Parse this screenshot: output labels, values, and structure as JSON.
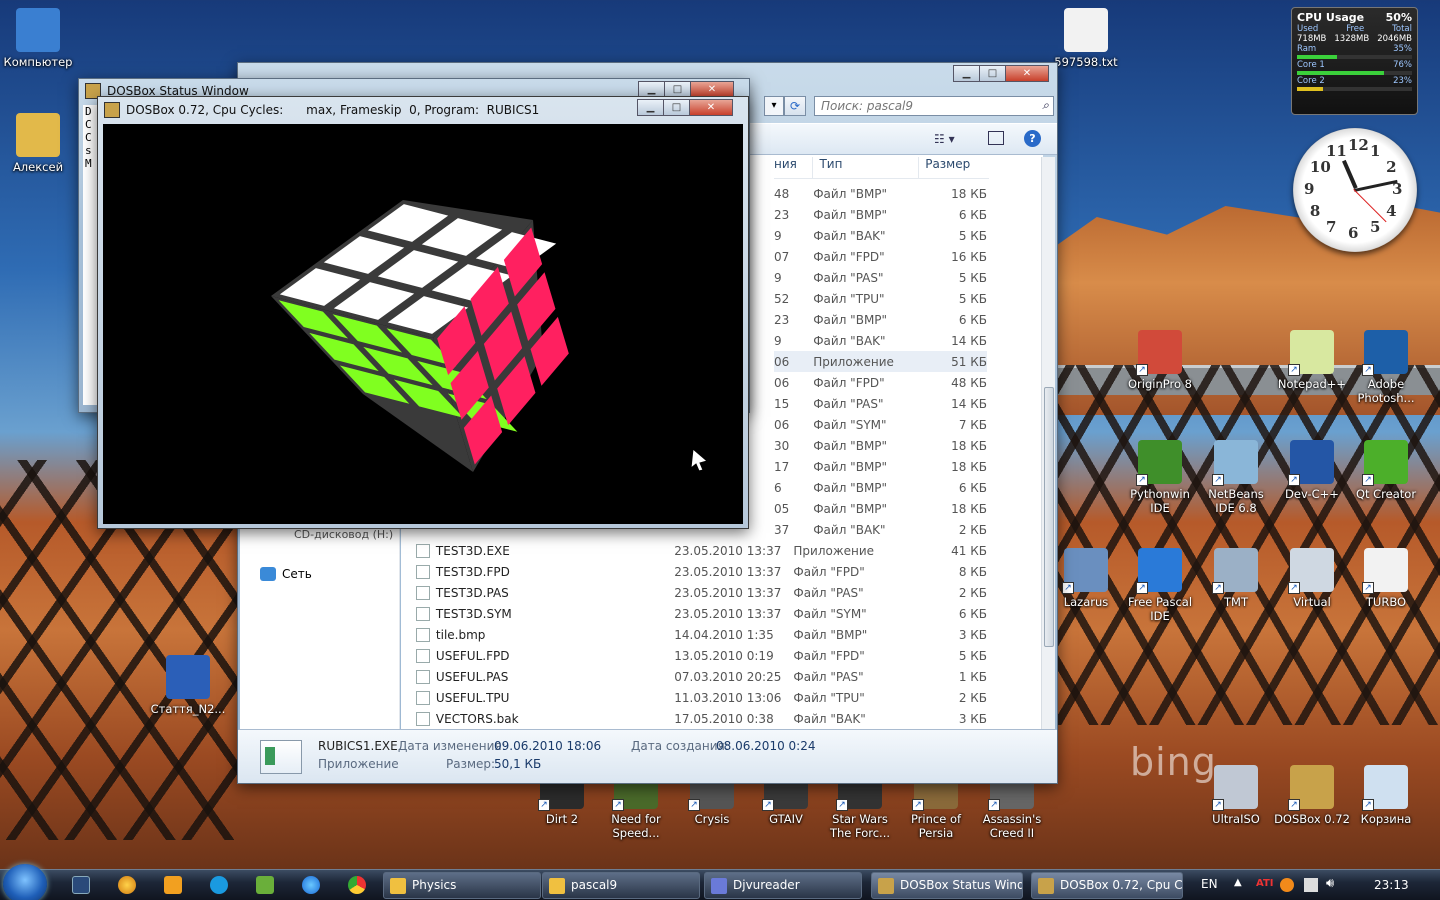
{
  "desktop_icons": [
    {
      "label": "Компьютер",
      "icon": "computer-icon",
      "color": "#3a7fd1"
    },
    {
      "label": "Алексей",
      "icon": "user-folder-icon",
      "color": "#e2b94a"
    },
    {
      "label": "Стаття_N2...",
      "icon": "word-document-icon",
      "color": "#2b5fb8"
    },
    {
      "label": "597598.txt",
      "icon": "text-file-icon",
      "color": "#f2f2f2"
    },
    {
      "label": "OriginPro 8",
      "icon": "originpro-icon",
      "color": "#d14a3a"
    },
    {
      "label": "Notepad++",
      "icon": "notepad-plus-icon",
      "color": "#d8e8a0"
    },
    {
      "label": "Adobe Photosh...",
      "icon": "photoshop-icon",
      "color": "#1d5fa8"
    },
    {
      "label": "Pythonwin IDE",
      "icon": "pythonwin-icon",
      "color": "#3f8f2a"
    },
    {
      "label": "NetBeans IDE 6.8",
      "icon": "netbeans-icon",
      "color": "#8ab6d8"
    },
    {
      "label": "Dev-C++",
      "icon": "devcpp-icon",
      "color": "#2456a6"
    },
    {
      "label": "Qt Creator",
      "icon": "qt-creator-icon",
      "color": "#4caf2a"
    },
    {
      "label": "Lazarus",
      "icon": "lazarus-icon",
      "color": "#6a8fbf"
    },
    {
      "label": "Free Pascal IDE",
      "icon": "free-pascal-icon",
      "color": "#2a7ad8"
    },
    {
      "label": "TMT",
      "icon": "tmt-icon",
      "color": "#9bb0c6"
    },
    {
      "label": "Virtual",
      "icon": "virtual-pascal-icon",
      "color": "#cfd8e2"
    },
    {
      "label": "TURBO",
      "icon": "turbo-file-icon",
      "color": "#f2f2f2"
    },
    {
      "label": "Dirt 2",
      "icon": "dirt2-icon",
      "color": "#2b2b2b"
    },
    {
      "label": "Need for Speed...",
      "icon": "nfs-icon",
      "color": "#4a6a2a"
    },
    {
      "label": "Crysis",
      "icon": "crysis-icon",
      "color": "#555"
    },
    {
      "label": "GTAIV",
      "icon": "gtaiv-icon",
      "color": "#3a3a3a"
    },
    {
      "label": "Star Wars The Forc...",
      "icon": "star-wars-icon",
      "color": "#333"
    },
    {
      "label": "Prince of Persia",
      "icon": "prince-persia-icon",
      "color": "#8a6a3a"
    },
    {
      "label": "Assassin's Creed II",
      "icon": "assassins-creed-icon",
      "color": "#666"
    },
    {
      "label": "UltraISO",
      "icon": "ultraiso-icon",
      "color": "#c0c8d4"
    },
    {
      "label": "DOSBox 0.72",
      "icon": "dosbox-icon",
      "color": "#c8a24a"
    },
    {
      "label": "Корзина",
      "icon": "recycle-bin-icon",
      "color": "#cfe0f0"
    }
  ],
  "cpu_gadget": {
    "title": "CPU Usage",
    "percent": "50%",
    "used_label": "Used",
    "free_label": "Free",
    "total_label": "Total",
    "used": "718MB",
    "free": "1328MB",
    "total": "2046MB",
    "ram_label": "Ram",
    "ram": "35%",
    "ram_fill": 0.35,
    "core1_label": "Core 1",
    "core1": "76%",
    "core1_fill": 0.76,
    "core2_label": "Core 2",
    "core2": "23%",
    "core2_fill": 0.23
  },
  "clock": {
    "numbers": [
      "12",
      "1",
      "2",
      "3",
      "4",
      "5",
      "6",
      "7",
      "8",
      "9",
      "10",
      "11"
    ],
    "hour": 11,
    "minute": 13
  },
  "explorer": {
    "search_placeholder": "Поиск: pascal9",
    "columns": {
      "name_partial": "ния",
      "type": "Тип",
      "size": "Размер"
    },
    "upper_rows": [
      {
        "date": "48",
        "type": "Файл \"BMP\"",
        "size": "18 КБ"
      },
      {
        "date": "23",
        "type": "Файл \"BMP\"",
        "size": "6 КБ"
      },
      {
        "date": "9",
        "type": "Файл \"BAK\"",
        "size": "5 КБ"
      },
      {
        "date": "07",
        "type": "Файл \"FPD\"",
        "size": "16 КБ"
      },
      {
        "date": "9",
        "type": "Файл \"PAS\"",
        "size": "5 КБ"
      },
      {
        "date": "52",
        "type": "Файл \"TPU\"",
        "size": "5 КБ"
      },
      {
        "date": "23",
        "type": "Файл \"BMP\"",
        "size": "6 КБ"
      },
      {
        "date": "9",
        "type": "Файл \"BAK\"",
        "size": "14 КБ"
      },
      {
        "date": "06",
        "type": "Приложение",
        "size": "51 КБ",
        "selected": true
      },
      {
        "date": "06",
        "type": "Файл \"FPD\"",
        "size": "48 КБ"
      },
      {
        "date": "15",
        "type": "Файл \"PAS\"",
        "size": "14 КБ"
      },
      {
        "date": "06",
        "type": "Файл \"SYM\"",
        "size": "7 КБ"
      },
      {
        "date": "30",
        "type": "Файл \"BMP\"",
        "size": "18 КБ"
      },
      {
        "date": "17",
        "type": "Файл \"BMP\"",
        "size": "18 КБ"
      },
      {
        "date": "6",
        "type": "Файл \"BMP\"",
        "size": "6 КБ"
      },
      {
        "date": "05",
        "type": "Файл \"BMP\"",
        "size": "18 КБ"
      },
      {
        "date": "37",
        "type": "Файл \"BAK\"",
        "size": "2 КБ"
      }
    ],
    "nav_partial": "CD-дисковод (H:)",
    "nav_network": "Сеть",
    "files": [
      {
        "name": "TEST3D.EXE",
        "date": "23.05.2010 13:37",
        "type": "Приложение",
        "size": "41 КБ"
      },
      {
        "name": "TEST3D.FPD",
        "date": "23.05.2010 13:37",
        "type": "Файл \"FPD\"",
        "size": "8 КБ"
      },
      {
        "name": "TEST3D.PAS",
        "date": "23.05.2010 13:37",
        "type": "Файл \"PAS\"",
        "size": "2 КБ"
      },
      {
        "name": "TEST3D.SYM",
        "date": "23.05.2010 13:37",
        "type": "Файл \"SYM\"",
        "size": "6 КБ"
      },
      {
        "name": "tile.bmp",
        "date": "14.04.2010 1:35",
        "type": "Файл \"BMP\"",
        "size": "3 КБ"
      },
      {
        "name": "USEFUL.FPD",
        "date": "13.05.2010 0:19",
        "type": "Файл \"FPD\"",
        "size": "5 КБ"
      },
      {
        "name": "USEFUL.PAS",
        "date": "07.03.2010 20:25",
        "type": "Файл \"PAS\"",
        "size": "1 КБ"
      },
      {
        "name": "USEFUL.TPU",
        "date": "11.03.2010 13:06",
        "type": "Файл \"TPU\"",
        "size": "2 КБ"
      },
      {
        "name": "VECTORS.bak",
        "date": "17.05.2010 0:38",
        "type": "Файл \"BAK\"",
        "size": "3 КБ"
      }
    ],
    "details": {
      "filename": "RUBICS1.EXE",
      "modified_label": "Дата изменения:",
      "modified": "09.06.2010 18:06",
      "created_label": "Дата создания:",
      "created": "08.06.2010 0:24",
      "kind": "Приложение",
      "size_label": "Размер:",
      "size": "50,1 КБ"
    }
  },
  "dosbox_status": {
    "title": "DOSBox Status Window",
    "side_letters": [
      "D",
      "C",
      "C",
      "s",
      "M"
    ]
  },
  "dosbox": {
    "title": "DOSBox 0.72, Cpu Cycles:      max, Frameskip  0, Program:  RUBICS1"
  },
  "taskbar": {
    "buttons": [
      {
        "label": "Physics",
        "icon": "folder-icon"
      },
      {
        "label": "pascal9",
        "icon": "folder-icon"
      },
      {
        "label": "Djvureader",
        "icon": "djvu-icon"
      },
      {
        "label": "DOSBox Status Wind...",
        "icon": "dosbox-icon"
      },
      {
        "label": "DOSBox 0.72, Cpu Cy...",
        "icon": "dosbox-icon"
      }
    ],
    "lang": "EN",
    "time": "23:13"
  },
  "wallpaper_text": "bing"
}
